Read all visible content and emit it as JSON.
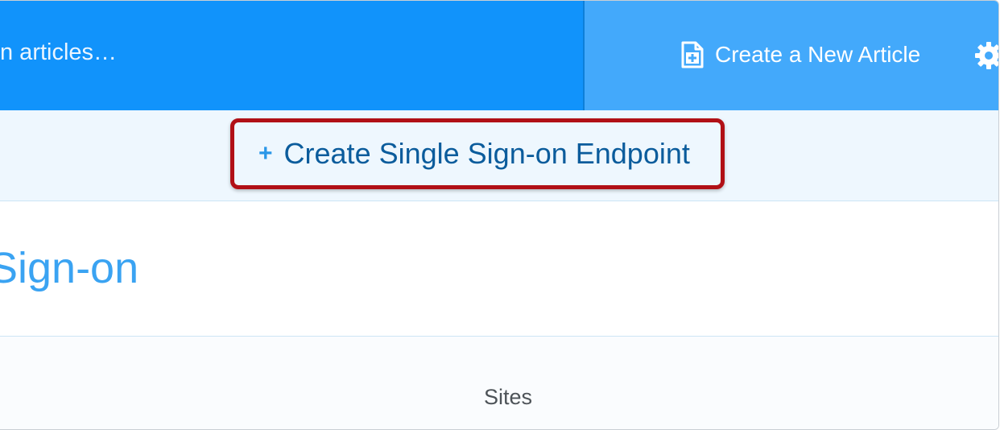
{
  "header": {
    "search_placeholder": "n articles…",
    "new_article_label": "Create a New Article",
    "colors": {
      "search_bg": "#1193fb",
      "action_bg": "#43a9fb"
    }
  },
  "toolbar": {
    "create_sso_label": "Create Single Sign-on Endpoint",
    "create_sso_icon": "plus-icon",
    "highlight_color": "#b11016"
  },
  "page": {
    "title": "Sign-on",
    "title_color": "#3aa3f2"
  },
  "section": {
    "label": "Sites"
  }
}
